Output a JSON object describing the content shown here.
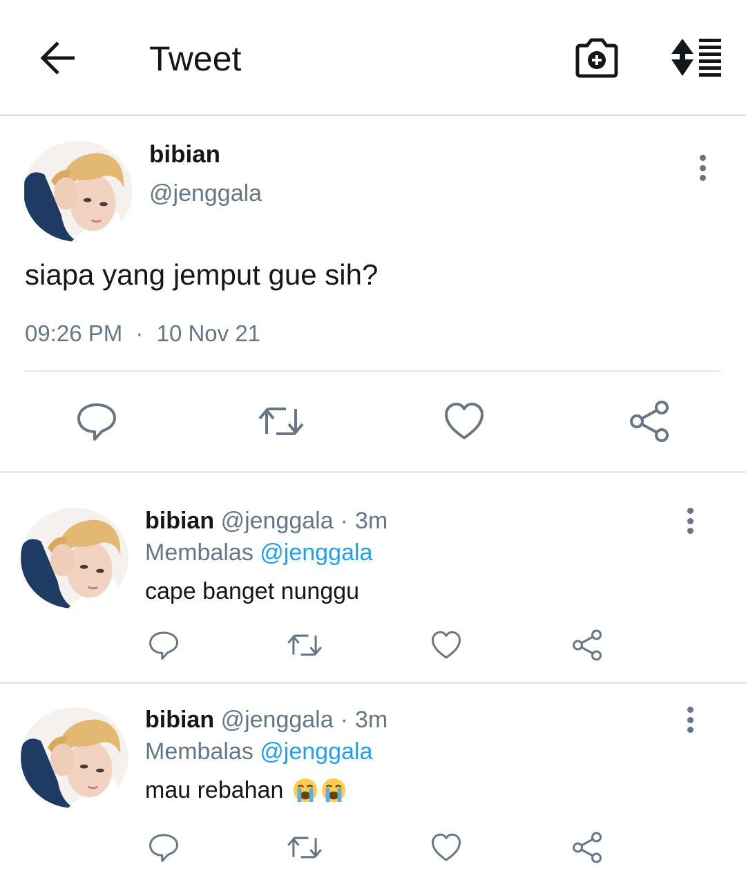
{
  "header": {
    "title": "Tweet",
    "back_icon": "arrow-left-icon",
    "camera_icon": "camera-plus-icon",
    "sort_icon": "sort-list-icon"
  },
  "main_tweet": {
    "name": "bibian",
    "handle": "@jenggala",
    "text": "siapa yang jemput gue sih?",
    "time": "09:26 PM",
    "separator": "·",
    "date": "10 Nov 21",
    "actions": [
      "reply-icon",
      "retweet-icon",
      "like-icon",
      "share-icon"
    ]
  },
  "replies": [
    {
      "name": "bibian",
      "handle": "@jenggala",
      "separator": "·",
      "age": "3m",
      "replying_label": "Membalas",
      "replying_to": "@jenggala",
      "text": "cape banget nunggu",
      "emoji": []
    },
    {
      "name": "bibian",
      "handle": "@jenggala",
      "separator": "·",
      "age": "3m",
      "replying_label": "Membalas",
      "replying_to": "@jenggala",
      "text": "mau rebahan",
      "emoji": [
        "loudly-crying-face",
        "loudly-crying-face"
      ]
    }
  ],
  "colors": {
    "text": "#14171a",
    "secondary": "#657786",
    "link": "#1da1f2",
    "divider": "#e1e6ea"
  }
}
